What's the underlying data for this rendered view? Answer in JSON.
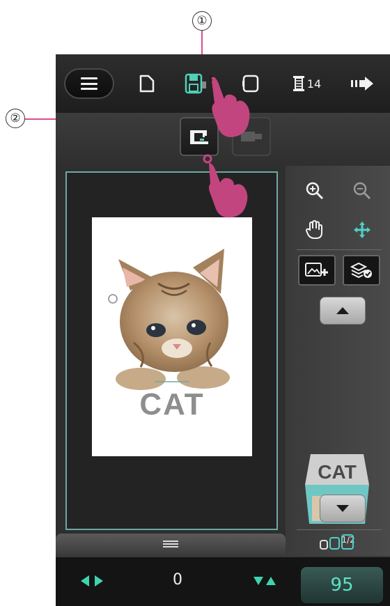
{
  "callouts": {
    "one": "①",
    "two": "②"
  },
  "toolbar": {
    "menu_icon": "hamburger-menu-icon",
    "new_icon": "new-document-icon",
    "save_icon": "save-icon",
    "hoop_icon": "hoop-frame-icon",
    "thread_icon": "thread-spool-icon",
    "thread_count": "14",
    "next_icon": "next-arrow-icon"
  },
  "subtoolbar": {
    "send_to_machine_icon": "sewing-machine-icon",
    "usb_icon": "usb-stick-icon"
  },
  "design": {
    "text": "CAT",
    "image": "cat-embroidery-image"
  },
  "sidepanel": {
    "zoom_in_icon": "zoom-in-icon",
    "zoom_out_icon": "zoom-out-icon",
    "pan_icon": "hand-pan-icon",
    "move_icon": "move-cross-icon",
    "add_image_icon": "add-image-icon",
    "layers_icon": "layers-check-icon",
    "thumbnail_text": "CAT",
    "page_indicator": "1/2"
  },
  "bottombar": {
    "position_value": "0",
    "speed_value": "95"
  },
  "colors": {
    "accent_pink": "#d94f8d",
    "teal": "#5fe3c8",
    "hoop_border": "#6ca9a3"
  }
}
